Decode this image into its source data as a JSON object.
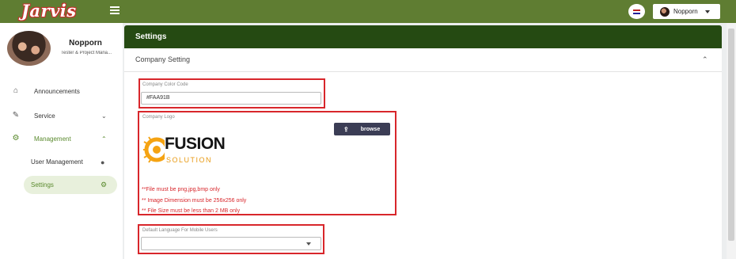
{
  "app": {
    "logo_text": "Jarvis"
  },
  "topbar": {
    "user_name": "Nopporn",
    "icons": {
      "menu": "hamburger-icon",
      "language": "flag-icon",
      "caret": "caret-down-icon"
    }
  },
  "sidebar": {
    "profile": {
      "name": "Nopporn",
      "role": "Tester & Project Mana..."
    },
    "items": [
      {
        "label": "Announcements",
        "icon": "home-icon",
        "glyph": "⌂"
      },
      {
        "label": "Service",
        "icon": "pencil-icon",
        "glyph": "✎",
        "chevron": "⌄"
      },
      {
        "label": "Management",
        "icon": "gear-icon",
        "glyph": "⚙",
        "chevron": "⌃"
      }
    ],
    "subitems": [
      {
        "label": "User Management",
        "icon": "person-icon",
        "glyph": "●"
      },
      {
        "label": "Settings",
        "icon": "gear-icon",
        "glyph": "⚙"
      }
    ],
    "accent_color": "#5a8a2e"
  },
  "settings": {
    "title": "Settings",
    "section_title": "Company Setting",
    "collapse_glyph": "⌃",
    "color_code": {
      "label": "Company Color Code",
      "value": "#FAA91B"
    },
    "logo": {
      "label": "Company Logo",
      "browse_label": "browse",
      "upload_glyph": "⇪",
      "brand_primary": "FUSION",
      "brand_secondary": "SOLUTION",
      "notes": [
        "**File must be png,jpg,bmp only",
        "** Image Dimension must be 256x256 only",
        "** File Size must be less than 2 MB only"
      ]
    },
    "language": {
      "label": "Default Language For Mobile Users",
      "value": ""
    }
  },
  "colors": {
    "topbar": "#5f7d32",
    "header": "#254a12",
    "highlight_box": "#d8262b",
    "brand_orange": "#faa91b"
  }
}
